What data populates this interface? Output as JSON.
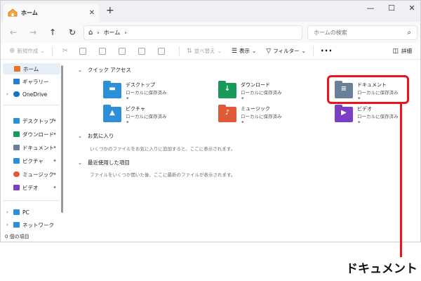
{
  "window": {
    "tab_label": "ホーム",
    "tab_close": "✕",
    "new_tab": "+",
    "controls": {
      "minimize": "—",
      "maximize": "☐",
      "close": "✕"
    }
  },
  "nav": {
    "back": "←",
    "forward": "→",
    "up": "↑",
    "refresh": "↻",
    "address": {
      "home_icon": "⌂",
      "sep1": "›",
      "segment": "ホーム",
      "sep2": "›"
    },
    "search_placeholder": "ホームの検索",
    "search_icon": "⌕"
  },
  "toolbar": {
    "new": "新規作成",
    "sort": "並べ替え",
    "view": "表示",
    "filter": "フィルター",
    "more": "•••",
    "details": "詳細",
    "dropdown": "⌄"
  },
  "sidebar": {
    "items": [
      {
        "label": "ホーム",
        "icon": "home-icon",
        "color": "#e8742c"
      },
      {
        "label": "ギャラリー",
        "icon": "gallery-icon",
        "color": "#2b7bd6"
      },
      {
        "label": "OneDrive",
        "icon": "onedrive-icon",
        "color": "#1a6fd1"
      },
      {
        "label": "デスクトップ",
        "icon": "desktop-icon",
        "color": "#2c8fd8"
      },
      {
        "label": "ダウンロード",
        "icon": "download-icon",
        "color": "#1a9a5a"
      },
      {
        "label": "ドキュメント",
        "icon": "documents-icon",
        "color": "#6a7f99"
      },
      {
        "label": "ピクチャ",
        "icon": "pictures-icon",
        "color": "#2c8fd8"
      },
      {
        "label": "ミュージック",
        "icon": "music-icon",
        "color": "#e05a3a"
      },
      {
        "label": "ビデオ",
        "icon": "video-icon",
        "color": "#7b3fc4"
      },
      {
        "label": "PC",
        "icon": "pc-icon",
        "color": "#2c8fd8"
      },
      {
        "label": "ネットワーク",
        "icon": "network-icon",
        "color": "#2c8fd8"
      }
    ],
    "pin": "📌",
    "chevron": "›"
  },
  "main": {
    "quick_access": {
      "title": "クイック アクセス",
      "items": [
        {
          "name": "デスクトップ",
          "status": "ローカルに保存済み",
          "color": "#2c8fd8",
          "glyph": "▬"
        },
        {
          "name": "ダウンロード",
          "status": "ローカルに保存済み",
          "color": "#1a9a5a",
          "glyph": "↓"
        },
        {
          "name": "ドキュメント",
          "status": "ローカルに保存済み",
          "color": "#6a7f99",
          "glyph": "≡"
        },
        {
          "name": "ピクチャ",
          "status": "ローカルに保存済み",
          "color": "#2c8fd8",
          "glyph": "▲"
        },
        {
          "name": "ミュージック",
          "status": "ローカルに保存済み",
          "color": "#e05a3a",
          "glyph": "♪"
        },
        {
          "name": "ビデオ",
          "status": "ローカルに保存済み",
          "color": "#7b3fc4",
          "glyph": "▶"
        }
      ]
    },
    "favorites": {
      "title": "お気に入り",
      "empty": "いくつかのファイルをお気に入りに追加すると、ここに表示されます。"
    },
    "recent": {
      "title": "最近使用した項目",
      "empty": "ファイルをいくつか開いた後、ここに最新のファイルが表示されます。"
    },
    "collapse_arrow": "⌄"
  },
  "status": {
    "count": "0 個の項目"
  },
  "callout": {
    "label": "ドキュメント",
    "color": "#e8141e"
  }
}
